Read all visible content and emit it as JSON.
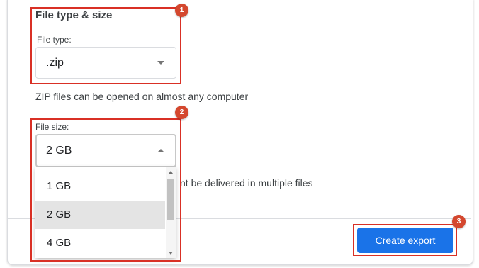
{
  "file_type_section": {
    "title": "File type & size",
    "file_type_label": "File type:",
    "file_type_value": ".zip",
    "file_type_helper": "ZIP files can be opened on almost any computer"
  },
  "file_size_section": {
    "label": "File size:",
    "selected_value": "2 GB",
    "helper_visible_fragment": "nt be delivered in multiple files",
    "options": [
      "1 GB",
      "2 GB",
      "4 GB"
    ],
    "highlighted_option": "2 GB"
  },
  "actions": {
    "create_export_label": "Create export"
  },
  "annotations": {
    "badge_1": "1",
    "badge_2": "2",
    "badge_3": "3",
    "box_color": "#d93025",
    "badge_color": "#d4472e"
  },
  "colors": {
    "primary_button": "#1a73e8"
  }
}
